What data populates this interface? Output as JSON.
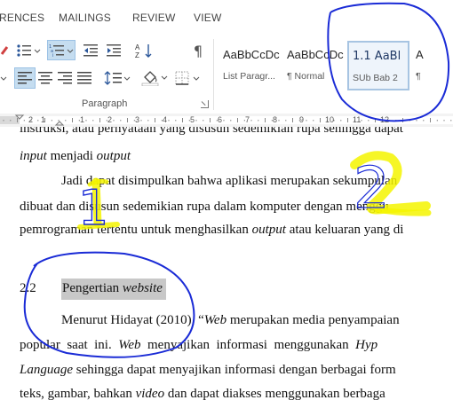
{
  "tabs": [
    "RENCES",
    "MAILINGS",
    "REVIEW",
    "VIEW"
  ],
  "ribbon": {
    "group_label": "Paragraph",
    "styles": [
      {
        "sample": "AaBbCcDc",
        "name": "List Paragr..."
      },
      {
        "sample": "AaBbCcDc",
        "name": "¶ Normal"
      },
      {
        "sample": "1.1  AaBl",
        "name": "SUb Bab 2"
      },
      {
        "sample": "A",
        "name": "¶"
      }
    ]
  },
  "ruler": {
    "numbers": [
      "2",
      "1",
      "1",
      "2",
      "3",
      "4",
      "5",
      "6",
      "7",
      "8",
      "9",
      "10",
      "11",
      "12"
    ]
  },
  "document": {
    "line0": "instruksi, atau pernyataan yang disusun sedemikian rupa sehingga dapat",
    "line1": {
      "a": "input",
      "b": " menjadi ",
      "c": "output"
    },
    "line2": "Jadi dapat disimpulkan bahwa aplikasi merupakan sekumpulan",
    "line3": "dibuat dan disusun sedemikian rupa dalam komputer dengan menggu",
    "line4": {
      "a": "pemrograman tertentu untuk menghasilkan ",
      "b": "output",
      "c": " atau keluaran yang di"
    },
    "heading": {
      "number": "2.2",
      "title_a": "Pengertian ",
      "title_b": "website"
    },
    "p1": {
      "a": "Menurut Hidayat (2010), “",
      "b": "Web",
      "c": " merupakan media penyampaian"
    },
    "p2": {
      "a": "popular  saat  ini.  ",
      "b": "Web",
      "c": "  menyajikan  informasi  menggunakan  ",
      "d": "Hyp"
    },
    "p3": {
      "a": "Language",
      "b": " sehingga dapat menyajikan informasi dengan berbagai form"
    },
    "p4": {
      "a": "teks, gambar, bahkan ",
      "b": "video",
      "c": " dan dapat diakses menggunakan berbaga"
    }
  },
  "annotations": {
    "mark1": "1",
    "mark2": "2",
    "ink_blue": "#1a2bd6",
    "ink_yellow": "#f4f400"
  }
}
